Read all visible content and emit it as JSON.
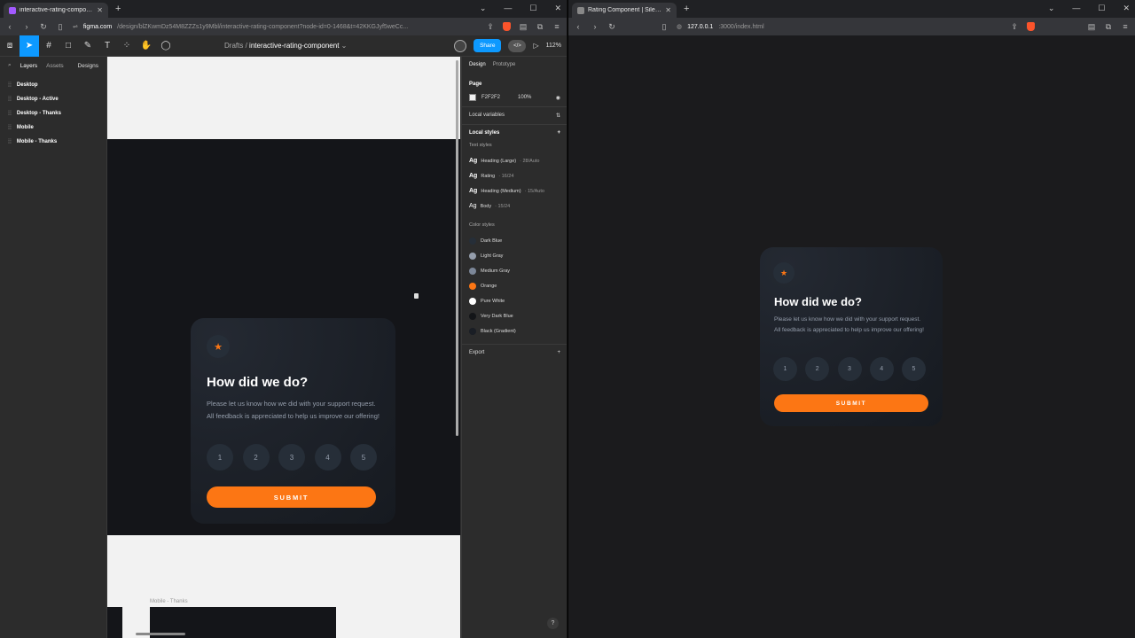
{
  "left_window": {
    "tab_title": "interactive-rating-component – Figma",
    "url_host": "figma.com",
    "url_path": "/design/blZKwmDz54M8ZZZs1y9Mbl/interactive-rating-component?node-id=0-1468&t=42KKGJyf5weCc...",
    "breadcrumb_parent": "Drafts",
    "breadcrumb_sep": "/",
    "file_name": "interactive-rating-component",
    "share_label": "Share",
    "devmode_label": "</>",
    "zoom_level": "112%",
    "layers_tab": "Layers",
    "assets_tab": "Assets",
    "pages_label": "Designs",
    "layers": [
      "Desktop",
      "Desktop - Active",
      "Desktop - Thanks",
      "Mobile",
      "Mobile - Thanks"
    ],
    "frame_label": "Mobile - Thanks",
    "design_panel": {
      "tab_design": "Design",
      "tab_prototype": "Prototype",
      "page_heading": "Page",
      "page_color": "F2F2F2",
      "page_opacity": "100%",
      "local_variables": "Local variables",
      "local_styles": "Local styles",
      "text_styles_heading": "Text styles",
      "text_styles": [
        {
          "ag": "Ag",
          "name": "Heading (Large)",
          "spec": "· 28/Auto"
        },
        {
          "ag": "Ag",
          "name": "Rating",
          "spec": "· 16/24"
        },
        {
          "ag": "Ag",
          "name": "Heading (Medium)",
          "spec": "· 15/Auto"
        },
        {
          "ag": "Ag",
          "name": "Body",
          "spec": "· 15/24"
        }
      ],
      "color_styles_heading": "Color styles",
      "color_styles": [
        {
          "name": "Dark Blue",
          "color": "#262e38"
        },
        {
          "name": "Light Gray",
          "color": "#959eac"
        },
        {
          "name": "Medium Gray",
          "color": "#7c8798"
        },
        {
          "name": "Orange",
          "color": "#fc7614"
        },
        {
          "name": "Pure White",
          "color": "#ffffff"
        },
        {
          "name": "Very Dark Blue",
          "color": "#131518"
        },
        {
          "name": "Black (Gradient)",
          "color": "#1a1e25"
        }
      ],
      "export_heading": "Export"
    },
    "help_label": "?"
  },
  "right_window": {
    "tab_title": "Rating Component | SilentScript",
    "url_host": "127.0.0.1",
    "url_rest": ":3000/index.html"
  },
  "rating_card": {
    "heading": "How did we do?",
    "body": "Please let us know how we did with your support request. All feedback is appreciated to help us improve our offering!",
    "ratings": [
      "1",
      "2",
      "3",
      "4",
      "5"
    ],
    "submit_label": "SUBMIT",
    "star_icon": "★"
  },
  "colors": {
    "accent": "#fc7614",
    "figma_blue": "#0d99ff"
  }
}
